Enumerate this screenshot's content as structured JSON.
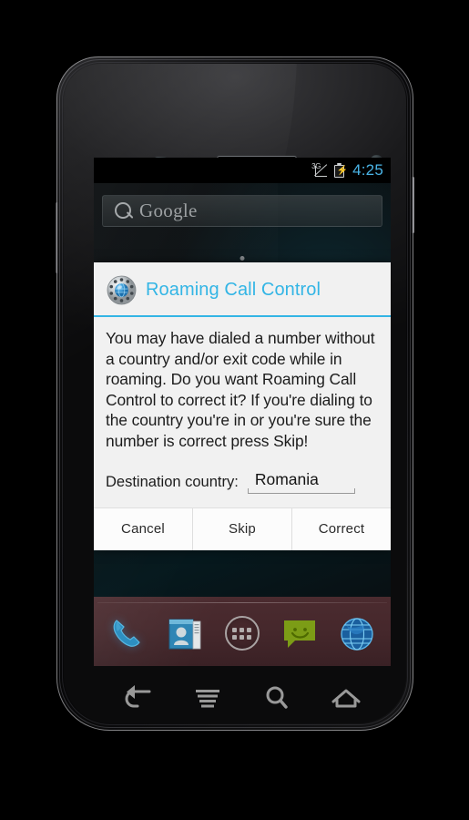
{
  "device": {
    "name": "android-phone",
    "hardware": {
      "earpiece": "earpiece-speaker",
      "front_camera": "front-camera",
      "proximity_sensor": "proximity-sensor",
      "light_sensor": "light-sensor",
      "power_button": "power-button",
      "volume_button": "volume-button"
    }
  },
  "statusbar": {
    "signal_label": "3G",
    "signal_icon": "signal-3g-icon",
    "battery_icon": "battery-charging-icon",
    "clock": "4:25",
    "clock_color": "#4ab4e6"
  },
  "homescreen": {
    "search_widget": {
      "icon": "search-icon",
      "brand": "Google",
      "placeholder": "Google"
    },
    "page_indicator": "page-indicator-dot",
    "dock": [
      {
        "name": "dock-item-phone",
        "label": "Phone",
        "icon": "phone-icon"
      },
      {
        "name": "dock-item-contacts",
        "label": "Contacts",
        "icon": "contacts-icon"
      },
      {
        "name": "dock-item-app-drawer",
        "label": "Apps",
        "icon": "app-drawer-icon"
      },
      {
        "name": "dock-item-messaging",
        "label": "Messaging",
        "icon": "message-icon"
      },
      {
        "name": "dock-item-browser",
        "label": "Browser",
        "icon": "globe-icon"
      }
    ]
  },
  "dialog": {
    "icon": "roaming-call-control-icon",
    "title": "Roaming Call Control",
    "title_color": "#33b5e5",
    "message": "You may have dialed a number without a country and/or exit code while in roaming. Do you want Roaming Call Control to correct it? If you're dialing to the country you're in or you're sure the number is correct press Skip!",
    "spinner_label": "Destination country:",
    "spinner_value": "Romania",
    "buttons": [
      {
        "name": "cancel-button",
        "label": "Cancel"
      },
      {
        "name": "skip-button",
        "label": "Skip"
      },
      {
        "name": "correct-button",
        "label": "Correct"
      }
    ]
  },
  "navbar": [
    {
      "name": "nav-back-button",
      "label": "Back",
      "icon": "back-arrow-icon"
    },
    {
      "name": "nav-menu-button",
      "label": "Menu",
      "icon": "menu-icon"
    },
    {
      "name": "nav-search-button",
      "label": "Search",
      "icon": "search-icon"
    },
    {
      "name": "nav-home-button",
      "label": "Home",
      "icon": "home-icon"
    }
  ]
}
